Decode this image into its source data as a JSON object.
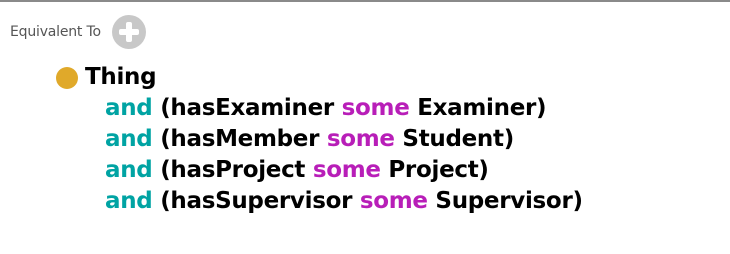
{
  "section": {
    "label": "Equivalent To",
    "add_icon": "plus-circle-icon"
  },
  "expression": {
    "class_name": "Thing",
    "class_icon": "class-dot-icon",
    "clauses": [
      {
        "connector": "and",
        "open": "(",
        "property": "hasExaminer ",
        "quantifier": "some",
        "filler": " Examiner",
        "close": ")"
      },
      {
        "connector": "and",
        "open": "(",
        "property": "hasMember ",
        "quantifier": "some",
        "filler": " Student",
        "close": ")"
      },
      {
        "connector": "and",
        "open": "(",
        "property": "hasProject ",
        "quantifier": "some",
        "filler": " Project",
        "close": ")"
      },
      {
        "connector": "and",
        "open": "(",
        "property": "hasSupervisor ",
        "quantifier": "some",
        "filler": " Supervisor",
        "close": ")"
      }
    ]
  },
  "colors": {
    "keyword_and": "#00a3a3",
    "keyword_some": "#b81eb8",
    "class_dot": "#e0a92a",
    "add_button": "#c8c8c8"
  }
}
